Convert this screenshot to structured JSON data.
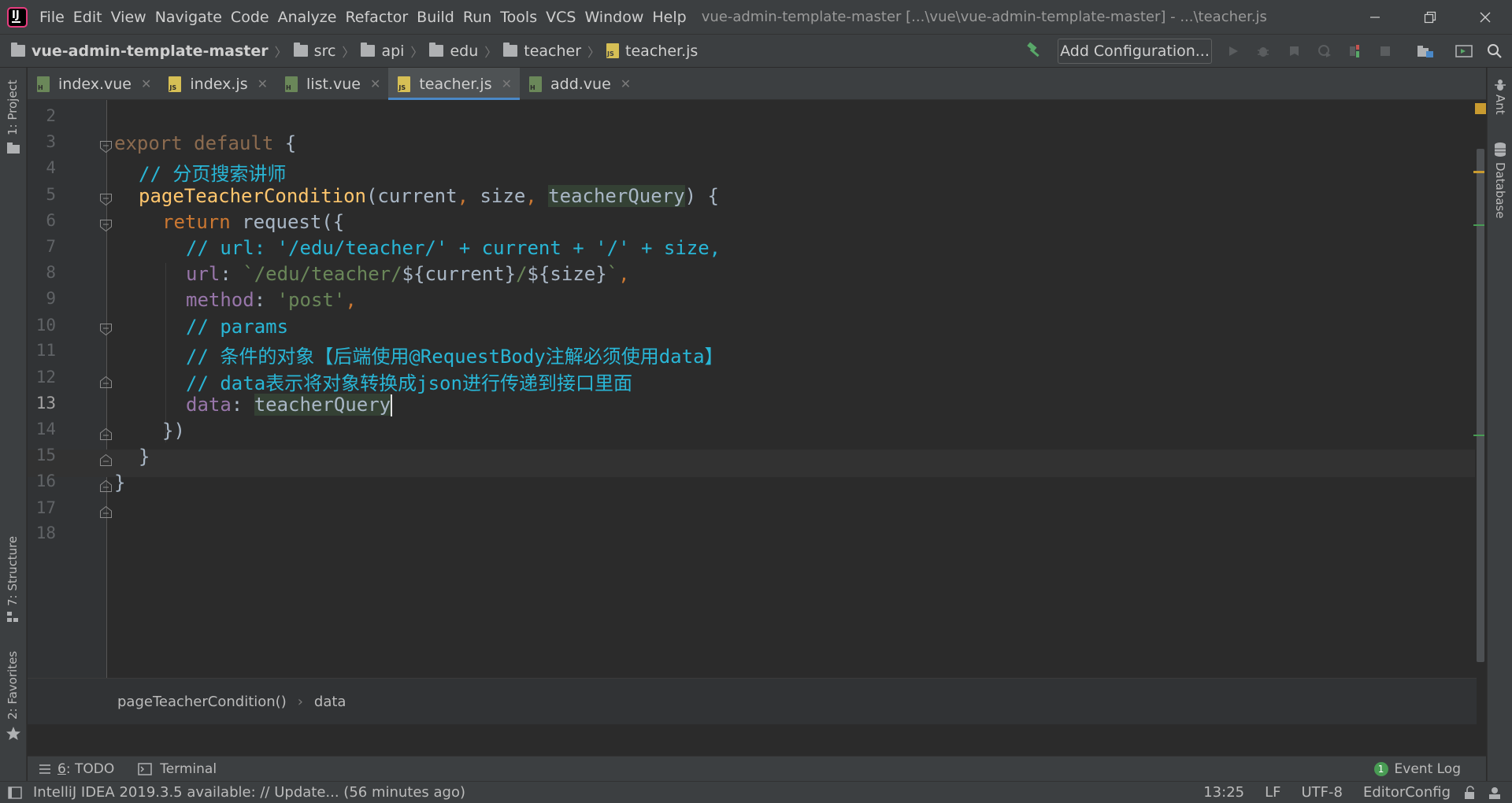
{
  "menubar": {
    "items": [
      "File",
      "Edit",
      "View",
      "Navigate",
      "Code",
      "Analyze",
      "Refactor",
      "Build",
      "Run",
      "Tools",
      "VCS",
      "Window",
      "Help"
    ],
    "title": "vue-admin-template-master [...\\vue\\vue-admin-template-master] - ...\\teacher.js",
    "app_icon_letters": "IJ"
  },
  "navbar": {
    "crumbs": [
      "vue-admin-template-master",
      "src",
      "api",
      "edu",
      "teacher",
      "teacher.js"
    ],
    "add_configuration": "Add Configuration..."
  },
  "left_tool_windows": {
    "project": "1: Project",
    "structure": "7: Structure",
    "favorites": "2: Favorites"
  },
  "right_tool_windows": {
    "ant": "Ant",
    "database": "Database"
  },
  "tabs": [
    {
      "label": "index.vue",
      "icon": "vue-file-icon",
      "active": false
    },
    {
      "label": "index.js",
      "icon": "js-file-icon",
      "active": false
    },
    {
      "label": "list.vue",
      "icon": "vue-file-icon",
      "active": false
    },
    {
      "label": "teacher.js",
      "icon": "js-file-icon",
      "active": true
    },
    {
      "label": "add.vue",
      "icon": "vue-file-icon",
      "active": false
    }
  ],
  "editor": {
    "line_numbers": [
      "2",
      "3",
      "4",
      "5",
      "6",
      "7",
      "8",
      "9",
      "10",
      "11",
      "12",
      "13",
      "14",
      "15",
      "16",
      "17",
      "18"
    ],
    "current_line": "13",
    "code": {
      "l3_a": "export default",
      "l3_b": " {",
      "l4": "// 分页搜索讲师",
      "l5_fn": "pageTeacherCondition",
      "l5_a": "(current",
      "l5_c1": ",",
      "l5_b": " size",
      "l5_c2": ",",
      "l5_param": "teacherQuery",
      "l5_end": ") {",
      "l6_kw": "return",
      "l6_rest": " request({",
      "l7": "// url: '/edu/teacher/' + current + '/' + size,",
      "l8_prop": "url",
      "l8_colon": ": ",
      "l8_tick1": "`",
      "l8_str": "/edu/teacher/",
      "l8_tmpl1": "${current}",
      "l8_slash": "/",
      "l8_tmpl2": "${size}",
      "l8_tick2": "`",
      "l8_comma": ",",
      "l9_prop": "method",
      "l9_colon": ": ",
      "l9_str": "'post'",
      "l9_comma": ",",
      "l10": "// params",
      "l11": "// 条件的对象【后端使用@RequestBody注解必须使用data】",
      "l12": "// data表示将对象转换成json进行传递到接口里面",
      "l13_prop": "data",
      "l13_colon": ": ",
      "l13_val": "teacherQuery",
      "l14": "})",
      "l15": "}",
      "l16": "}"
    },
    "code_crumbs": [
      "pageTeacherCondition()",
      "data"
    ]
  },
  "toolwindows": {
    "todo_num": "6",
    "todo_label": ": TODO",
    "terminal": "Terminal",
    "event_log_count": "1",
    "event_log": "Event Log"
  },
  "status": {
    "message": "IntelliJ IDEA 2019.3.5 available: // Update... (56 minutes ago)",
    "position": "13:25",
    "line_sep": "LF",
    "encoding": "UTF-8",
    "editorconfig": "EditorConfig"
  },
  "colors": {
    "keyword": "#cc7832",
    "function": "#ffc66d",
    "comment": "#29b6d6",
    "string": "#6a8759",
    "property": "#9876aa",
    "accent": "#4a88c7"
  }
}
